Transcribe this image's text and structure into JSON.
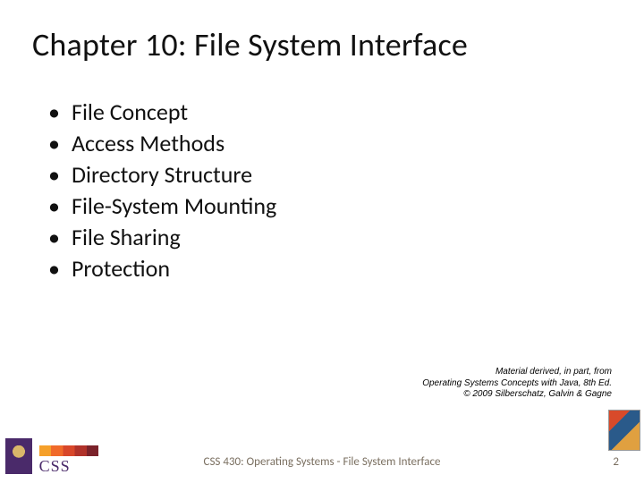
{
  "title": "Chapter 10:  File System Interface",
  "bullets": [
    "File Concept",
    "Access Methods",
    "Directory Structure",
    "File-System Mounting",
    "File Sharing",
    "Protection"
  ],
  "attribution": {
    "line1": "Material derived, in part, from",
    "line2": "Operating Systems Concepts with Java, 8th Ed.",
    "line3": "© 2009 Silberschatz, Galvin & Gagne"
  },
  "footer": {
    "center": "CSS 430: Operating Systems - File System Interface",
    "page": "2",
    "css_label": "CSS"
  }
}
